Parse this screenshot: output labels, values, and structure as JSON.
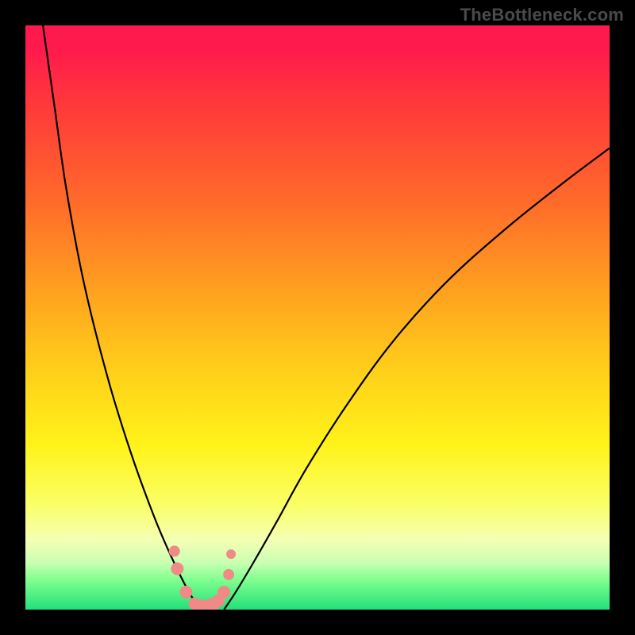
{
  "watermark": "TheBottleneck.com",
  "chart_data": {
    "type": "line",
    "title": "",
    "xlabel": "",
    "ylabel": "",
    "xlim": [
      0,
      100
    ],
    "ylim": [
      0,
      100
    ],
    "gradient_bands": [
      {
        "color": "#ff1a4d",
        "stop": 0
      },
      {
        "color": "#ff3a3a",
        "stop": 14
      },
      {
        "color": "#ff6a2a",
        "stop": 30
      },
      {
        "color": "#ffa31f",
        "stop": 46
      },
      {
        "color": "#ffd21a",
        "stop": 60
      },
      {
        "color": "#fff31a",
        "stop": 72
      },
      {
        "color": "#faff66",
        "stop": 82
      },
      {
        "color": "#f6ffb3",
        "stop": 88
      },
      {
        "color": "#c9ffb3",
        "stop": 92
      },
      {
        "color": "#7dff8e",
        "stop": 95
      },
      {
        "color": "#22e07a",
        "stop": 100
      }
    ],
    "series": [
      {
        "name": "left-curve",
        "x": [
          3,
          5,
          7,
          10,
          14,
          18,
          22,
          25,
          28,
          30
        ],
        "y": [
          100,
          86,
          72,
          56,
          40,
          27,
          16,
          9,
          3,
          0
        ]
      },
      {
        "name": "right-curve",
        "x": [
          34,
          36,
          39,
          43,
          48,
          55,
          63,
          72,
          82,
          92,
          100
        ],
        "y": [
          0,
          3,
          8,
          15,
          24,
          35,
          46,
          56,
          65,
          73,
          79
        ]
      }
    ],
    "points": {
      "name": "marker-cluster",
      "color": "#f08a86",
      "x": [
        25.5,
        26.0,
        27.5,
        29.0,
        30.5,
        32.0,
        33.0,
        34.0,
        34.8,
        35.2
      ],
      "y": [
        10.0,
        7.0,
        3.0,
        1.0,
        0.5,
        0.8,
        1.5,
        3.0,
        6.0,
        9.5
      ],
      "r": [
        7,
        8,
        8,
        8,
        9,
        9,
        8,
        8,
        7,
        6
      ]
    }
  }
}
